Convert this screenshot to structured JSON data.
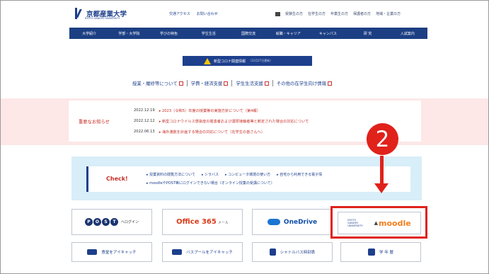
{
  "header": {
    "logo_name": "京都産業大学",
    "logo_sub": "KYOTO SANGYO UNIVERSITY",
    "links": [
      "交通アクセス",
      "お問い合わせ"
    ],
    "audience": [
      "受験生の方",
      "在学生の方",
      "卒業生の方",
      "保護者の方",
      "地域・企業の方"
    ]
  },
  "nav": [
    "大学紹介",
    "学部・大学院",
    "学びの特色",
    "学生生活",
    "国際交流",
    "就職・キャリア",
    "キャンパス",
    "研 究",
    "入試案内"
  ],
  "covid": {
    "label": "新型コロナ関連情報",
    "date": "（12月27日更新）"
  },
  "sublinks": [
    "授業・履修等について",
    "学費・経済支援",
    "学生生活支援",
    "その他の在学生向け情報"
  ],
  "notice": {
    "title": "重要なお知らせ",
    "items": [
      {
        "date": "2022.12.19",
        "text": "▸ 2023（令和5）年度の授業等の実施方針について（第4報）"
      },
      {
        "date": "2022.12.12",
        "text": "▸ 新型コロナウイルス感染症の罹患者および濃厚接触者等と断定された場合の対応について"
      },
      {
        "date": "2022.06.13",
        "text": "▸ 海外渡航を計画する場合の対応について（在学生の皆さんへ）"
      }
    ]
  },
  "check": {
    "title": "Check!",
    "links_row1": [
      "▸ 授業資料の閲覧方法について",
      "▸ シラバス",
      "▸ コンピュータ環境の使い方",
      "▸ 自宅から利用できる電子情"
    ],
    "links_row2": "▸ moodleやPOST等にログインできない場合（オンライン授業の受講について）"
  },
  "buttons": {
    "post_letters": [
      "P",
      "O",
      "S",
      "T"
    ],
    "post_sub": "へログイン",
    "office": "Office 365",
    "office_mail": "メール",
    "onedrive": "OneDrive",
    "moodle_left": "KYOTO\nSANGYO\nUNIVERSITY",
    "moodle": "moodle",
    "row2": [
      "食堂をアイキャッチ",
      "バスプールをアイキャッチ",
      "シャトルバス時刻表",
      "学 年 暦"
    ]
  },
  "annotation": {
    "step": "2"
  },
  "colors": {
    "navy": "#1c3f84",
    "red": "#e0221b",
    "notice_bg": "#fde7e7",
    "check_bg": "#d8eef8"
  }
}
